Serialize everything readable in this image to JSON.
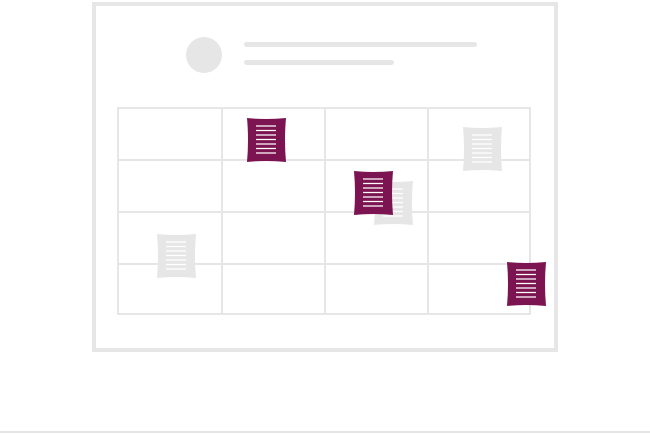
{
  "colors": {
    "accent": "#7b1450",
    "neutral": "#e6e6e6",
    "note_line_accent": "#ffffff",
    "note_line_neutral": "#ffffff"
  },
  "icons": {
    "avatar": "avatar-placeholder-icon",
    "note": "document-note-icon"
  },
  "calendar": {
    "rows": 4,
    "columns": 4
  },
  "notes": [
    {
      "color": "accent",
      "name": "note-accent-1"
    },
    {
      "color": "accent",
      "name": "note-accent-2"
    },
    {
      "color": "accent",
      "name": "note-accent-3"
    },
    {
      "color": "neutral",
      "name": "note-neutral-1"
    },
    {
      "color": "neutral",
      "name": "note-neutral-2"
    },
    {
      "color": "neutral",
      "name": "note-neutral-3"
    }
  ]
}
